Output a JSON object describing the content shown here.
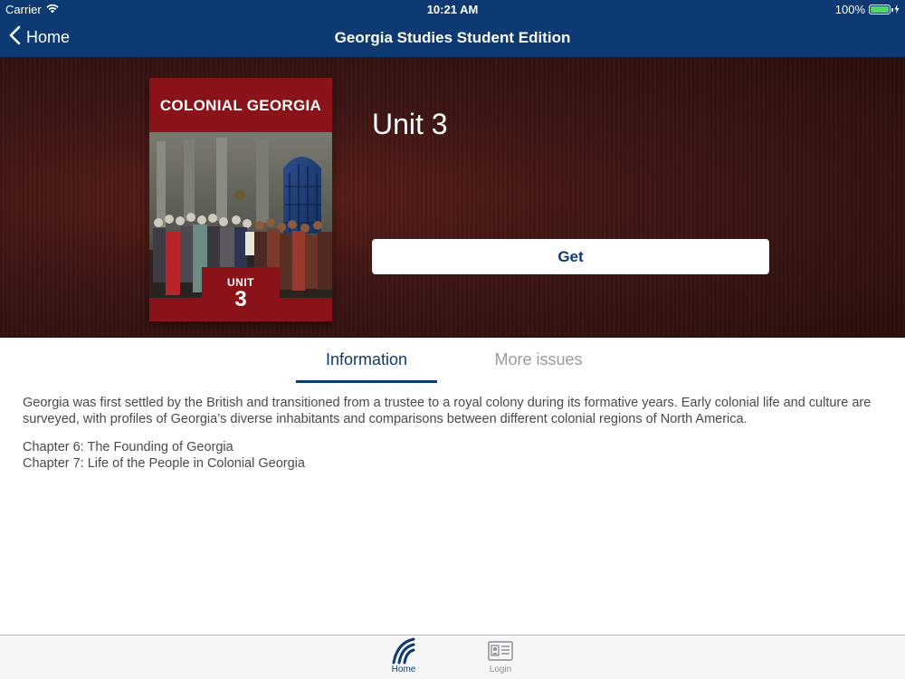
{
  "status_bar": {
    "carrier": "Carrier",
    "time": "10:21 AM",
    "battery": "100%",
    "battery_level": 1.0
  },
  "nav": {
    "back_label": "Home",
    "title": "Georgia Studies Student Edition"
  },
  "issue": {
    "cover_title": "COLONIAL GEORGIA",
    "cover_unit_word": "UNIT",
    "cover_unit_number": "3",
    "title": "Unit 3",
    "get_label": "Get"
  },
  "tabs": [
    {
      "label": "Information",
      "selected": true
    },
    {
      "label": "More issues",
      "selected": false
    }
  ],
  "information": {
    "description": "Georgia was first settled by the British and transitioned from a trustee to a royal colony during its formative years. Early colonial life and culture are surveyed, with profiles of Georgia’s diverse inhabitants and comparisons between different colonial regions of North America.",
    "chapters": [
      "Chapter 6: The Founding of Georgia",
      "Chapter 7: Life of the People in Colonial Georgia"
    ]
  },
  "tab_bar": [
    {
      "label": "Home",
      "icon": "home-logo-icon",
      "selected": true
    },
    {
      "label": "Login",
      "icon": "id-card-icon",
      "selected": false
    }
  ],
  "colors": {
    "brand_navy": "#0d3a73",
    "cover_red": "#8a1219",
    "hero_dark_red": "#3d1512",
    "battery_green": "#4cd964"
  }
}
